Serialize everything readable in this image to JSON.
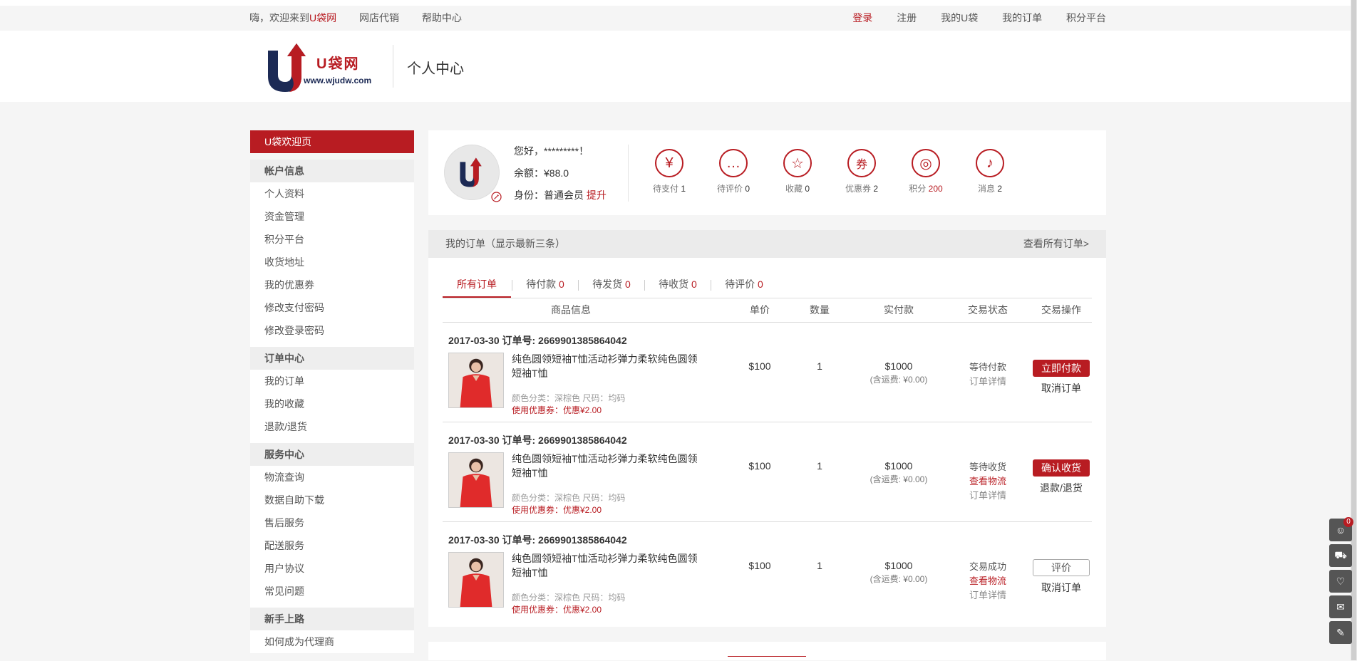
{
  "topbar": {
    "welcome_prefix": "嗨，欢迎来到",
    "welcome_brand": "U袋网",
    "links_left": [
      "网店代销",
      "帮助中心"
    ],
    "login": "登录",
    "links_right": [
      "注册",
      "我的U袋",
      "我的订单",
      "积分平台"
    ]
  },
  "header": {
    "logo_text": "U袋网",
    "logo_url": "www.wjudw.com",
    "page_title": "个人中心"
  },
  "sidebar": {
    "active": "U袋欢迎页",
    "groups": [
      {
        "title": "帐户信息",
        "items": [
          "个人资料",
          "资金管理",
          "积分平台",
          "收货地址",
          "我的优惠券",
          "修改支付密码",
          "修改登录密码"
        ]
      },
      {
        "title": "订单中心",
        "items": [
          "我的订单",
          "我的收藏",
          "退款/退货"
        ]
      },
      {
        "title": "服务中心",
        "items": [
          "物流查询",
          "数据自助下载",
          "售后服务",
          "配送服务",
          "用户协议",
          "常见问题"
        ]
      },
      {
        "title": "新手上路",
        "items": [
          "如何成为代理商"
        ]
      }
    ]
  },
  "user": {
    "greeting": "您好，*********！",
    "balance": "余额：¥88.0",
    "identity_label": "身份：普通会员",
    "upgrade": "提升"
  },
  "stats": [
    {
      "icon": "yen-icon",
      "glyph": "¥",
      "label": "待支付",
      "count": "1",
      "red": false
    },
    {
      "icon": "chat-icon",
      "glyph": "…",
      "label": "待评价",
      "count": "0",
      "red": false
    },
    {
      "icon": "star-icon",
      "glyph": "☆",
      "label": "收藏",
      "count": "0",
      "red": false
    },
    {
      "icon": "coupon-icon",
      "glyph": "券",
      "label": "优惠券",
      "count": "2",
      "red": false
    },
    {
      "icon": "coins-icon",
      "glyph": "◎",
      "label": "积分",
      "count": "200",
      "red": true
    },
    {
      "icon": "bell-icon",
      "glyph": "♪",
      "label": "消息",
      "count": "2",
      "red": false
    }
  ],
  "orders": {
    "title": "我的订单（显示最新三条）",
    "view_all": "查看所有订单>",
    "tabs": [
      {
        "label": "所有订单",
        "count": ""
      },
      {
        "label": "待付款",
        "count": "0"
      },
      {
        "label": "待发货",
        "count": "0"
      },
      {
        "label": "待收货",
        "count": "0"
      },
      {
        "label": "待评价",
        "count": "0"
      }
    ],
    "columns": [
      "商品信息",
      "单价",
      "数量",
      "实付款",
      "交易状态",
      "交易操作"
    ],
    "rows": [
      {
        "meta": "2017-03-30 订单号: 2669901385864042",
        "name": "纯色圆领短袖T恤活动衫弹力柔软纯色圆领短袖T恤",
        "spec": "颜色分类：深棕色 尺码：均码",
        "coupon": "使用优惠券：优惠¥2.00",
        "price": "$100",
        "qty": "1",
        "pay": "$1000",
        "ship": "(含运费: ¥0.00)",
        "status": "等待付款",
        "status_red": "",
        "status_link": "订单详情",
        "op_primary": "立即付款",
        "op_primary_style": "red",
        "op_secondary": "取消订单"
      },
      {
        "meta": "2017-03-30 订单号: 2669901385864042",
        "name": "纯色圆领短袖T恤活动衫弹力柔软纯色圆领短袖T恤",
        "spec": "颜色分类：深棕色 尺码：均码",
        "coupon": "使用优惠券：优惠¥2.00",
        "price": "$100",
        "qty": "1",
        "pay": "$1000",
        "ship": "(含运费: ¥0.00)",
        "status": "等待收货",
        "status_red": "查看物流",
        "status_link": "订单详情",
        "op_primary": "确认收货",
        "op_primary_style": "red",
        "op_secondary": "退款/退货"
      },
      {
        "meta": "2017-03-30 订单号: 2669901385864042",
        "name": "纯色圆领短袖T恤活动衫弹力柔软纯色圆领短袖T恤",
        "spec": "颜色分类：深棕色 尺码：均码",
        "coupon": "使用优惠券：优惠¥2.00",
        "price": "$100",
        "qty": "1",
        "pay": "$1000",
        "ship": "(含运费: ¥0.00)",
        "status": "交易成功",
        "status_red": "查看物流",
        "status_link": "订单详情",
        "op_primary": "评价",
        "op_primary_style": "line",
        "op_secondary": "取消订单"
      }
    ]
  },
  "right_tools": [
    {
      "icon": "user-icon",
      "glyph": "☺",
      "badge": "0"
    },
    {
      "icon": "cart-icon",
      "glyph": "⛟",
      "badge": ""
    },
    {
      "icon": "heart-icon",
      "glyph": "♡",
      "badge": ""
    },
    {
      "icon": "message-icon",
      "glyph": "✉",
      "badge": ""
    },
    {
      "icon": "edit-icon",
      "glyph": "✎",
      "badge": ""
    }
  ],
  "colors": {
    "brand_red": "#b81c22",
    "brand_navy": "#1c2a55"
  }
}
